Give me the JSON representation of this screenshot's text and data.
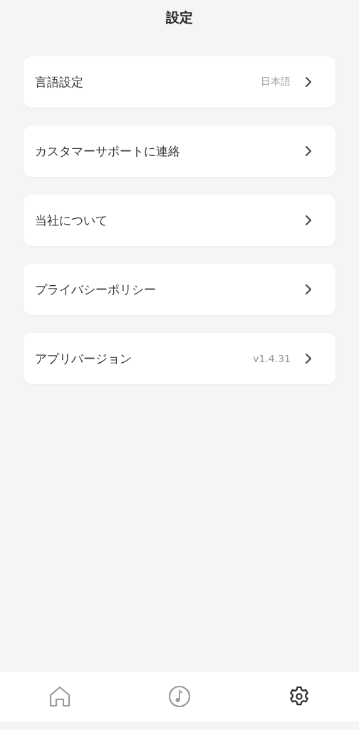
{
  "header": {
    "title": "設定"
  },
  "items": [
    {
      "label": "言語設定",
      "value": "日本語"
    },
    {
      "label": "カスタマーサポートに連絡"
    },
    {
      "label": "当社について"
    },
    {
      "label": "プライバシーポリシー"
    },
    {
      "label": "アプリバージョン",
      "value": "v1.4.31"
    }
  ],
  "tab_bar": [
    {
      "kind": "home",
      "selected": false
    },
    {
      "kind": "music",
      "selected": false
    },
    {
      "kind": "settings",
      "selected": true
    }
  ]
}
